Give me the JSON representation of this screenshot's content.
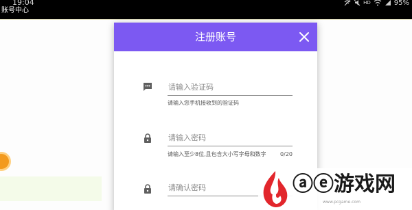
{
  "status_bar": {
    "time": "19:04",
    "app_name": "账号中心",
    "battery": "95%"
  },
  "dialog": {
    "title": "注册账号",
    "fields": [
      {
        "icon": "message-icon",
        "placeholder": "请输入验证码",
        "hint": "请输入您手机接收到的验证码"
      },
      {
        "icon": "lock-icon",
        "placeholder": "请输入密码",
        "hint": "请输入至少8位,且包含大小写字母和数字",
        "counter": "0/20"
      },
      {
        "icon": "lock-icon",
        "placeholder": "请确认密码"
      }
    ]
  },
  "watermark": {
    "text": "ⓐⓔ游戏网",
    "url": "www.pcgame.com"
  },
  "colors": {
    "header": "#7c59f2",
    "accent_orange": "#f39a1e",
    "logo_red": "#e2262c"
  }
}
